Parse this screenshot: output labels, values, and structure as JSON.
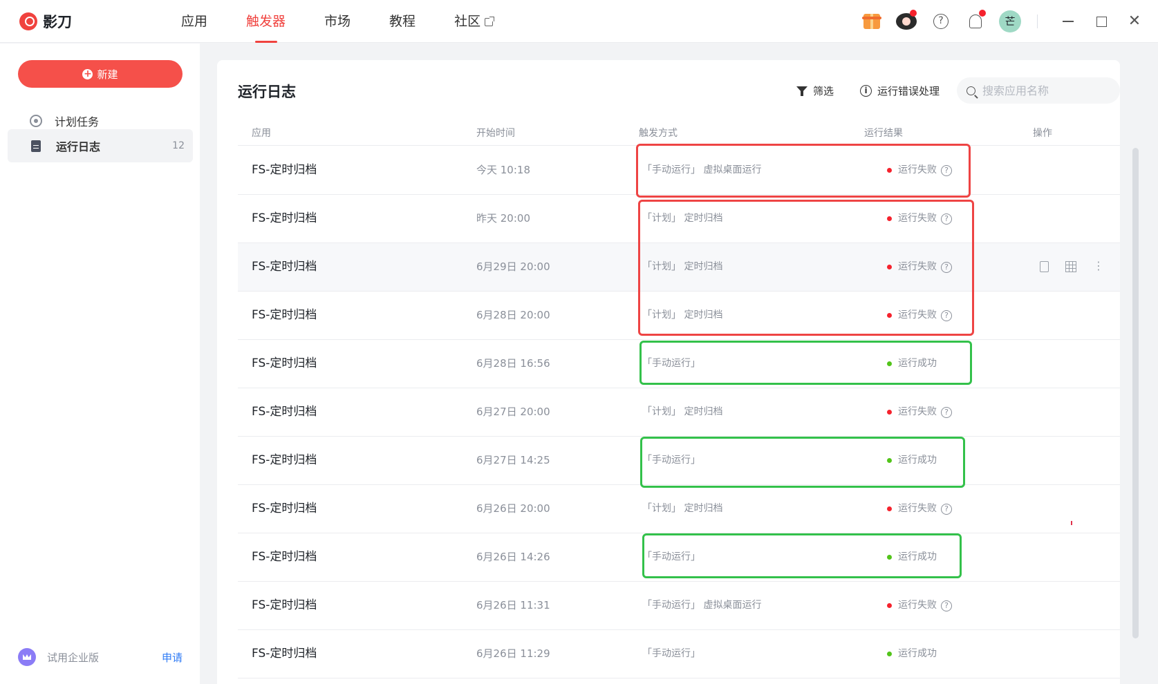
{
  "app": {
    "name": "影刀"
  },
  "nav": [
    {
      "label": "应用",
      "active": false
    },
    {
      "label": "触发器",
      "active": true
    },
    {
      "label": "市场",
      "active": false
    },
    {
      "label": "教程",
      "active": false
    },
    {
      "label": "社区",
      "active": false,
      "external": true
    }
  ],
  "topbar": {
    "icons": [
      "gift-icon",
      "eye-icon",
      "help-icon",
      "bell-icon"
    ],
    "avatar_text": "芒",
    "help_glyph": "?"
  },
  "sidebar": {
    "new_label": "新建",
    "items": [
      {
        "label": "计划任务",
        "icon": "radar-icon",
        "count": ""
      },
      {
        "label": "运行日志",
        "icon": "document-icon",
        "count": "12",
        "active": true
      }
    ],
    "trial_label": "试用企业版",
    "apply_label": "申请"
  },
  "main": {
    "title": "运行日志",
    "filter_label": "筛选",
    "error_label": "运行错误处理",
    "search_placeholder": "搜索应用名称",
    "columns": [
      "应用",
      "开始时间",
      "触发方式",
      "运行结果",
      "操作"
    ],
    "rows": [
      {
        "app": "FS-定时归档",
        "time": "今天 10:18",
        "trigger": "「手动运行」 虚拟桌面运行",
        "result": "运行失败",
        "status": "fail"
      },
      {
        "app": "FS-定时归档",
        "time": "昨天 20:00",
        "trigger": "「计划」 定时归档",
        "result": "运行失败",
        "status": "fail"
      },
      {
        "app": "FS-定时归档",
        "time": "6月29日 20:00",
        "trigger": "「计划」 定时归档",
        "result": "运行失败",
        "status": "fail",
        "hover": true
      },
      {
        "app": "FS-定时归档",
        "time": "6月28日 20:00",
        "trigger": "「计划」 定时归档",
        "result": "运行失败",
        "status": "fail"
      },
      {
        "app": "FS-定时归档",
        "time": "6月28日 16:56",
        "trigger": "「手动运行」",
        "result": "运行成功",
        "status": "ok"
      },
      {
        "app": "FS-定时归档",
        "time": "6月27日 20:00",
        "trigger": "「计划」 定时归档",
        "result": "运行失败",
        "status": "fail"
      },
      {
        "app": "FS-定时归档",
        "time": "6月27日 14:25",
        "trigger": "「手动运行」",
        "result": "运行成功",
        "status": "ok"
      },
      {
        "app": "FS-定时归档",
        "time": "6月26日 20:00",
        "trigger": "「计划」 定时归档",
        "result": "运行失败",
        "status": "fail"
      },
      {
        "app": "FS-定时归档",
        "time": "6月26日 14:26",
        "trigger": "「手动运行」",
        "result": "运行成功",
        "status": "ok"
      },
      {
        "app": "FS-定时归档",
        "time": "6月26日 11:31",
        "trigger": "「手动运行」 虚拟桌面运行",
        "result": "运行失败",
        "status": "fail"
      },
      {
        "app": "FS-定时归档",
        "time": "6月26日 11:29",
        "trigger": "「手动运行」",
        "result": "运行成功",
        "status": "ok"
      }
    ]
  },
  "colors": {
    "accent": "#f0423e",
    "fail": "#f5222d",
    "success": "#52c41a",
    "annotation_red": "#ee4444",
    "annotation_green": "#33c14a"
  }
}
